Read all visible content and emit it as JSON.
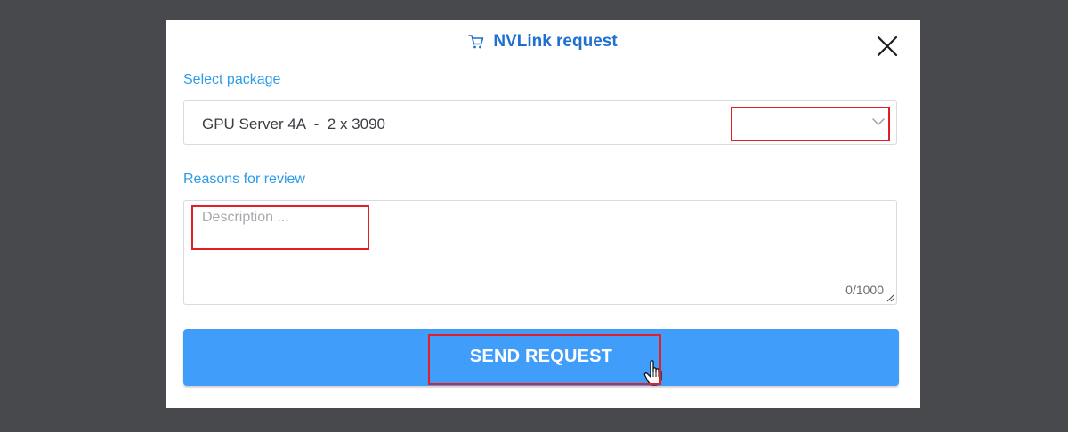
{
  "modal": {
    "title": "NVLink request",
    "title_icon": "cart-icon",
    "close_icon": "close-icon"
  },
  "package": {
    "label": "Select package",
    "selected_value": "GPU Server 4A  -  2 x 3090",
    "dropdown_icon": "chevron-down-icon"
  },
  "review": {
    "label": "Reasons for review",
    "placeholder": "Description ...",
    "counter": "0/1000"
  },
  "actions": {
    "send_label": "SEND REQUEST"
  },
  "colors": {
    "backdrop": "#48494c",
    "title": "#1f6fd1",
    "label": "#2d9be8",
    "button": "#419dfa",
    "highlight": "#e11f26"
  }
}
